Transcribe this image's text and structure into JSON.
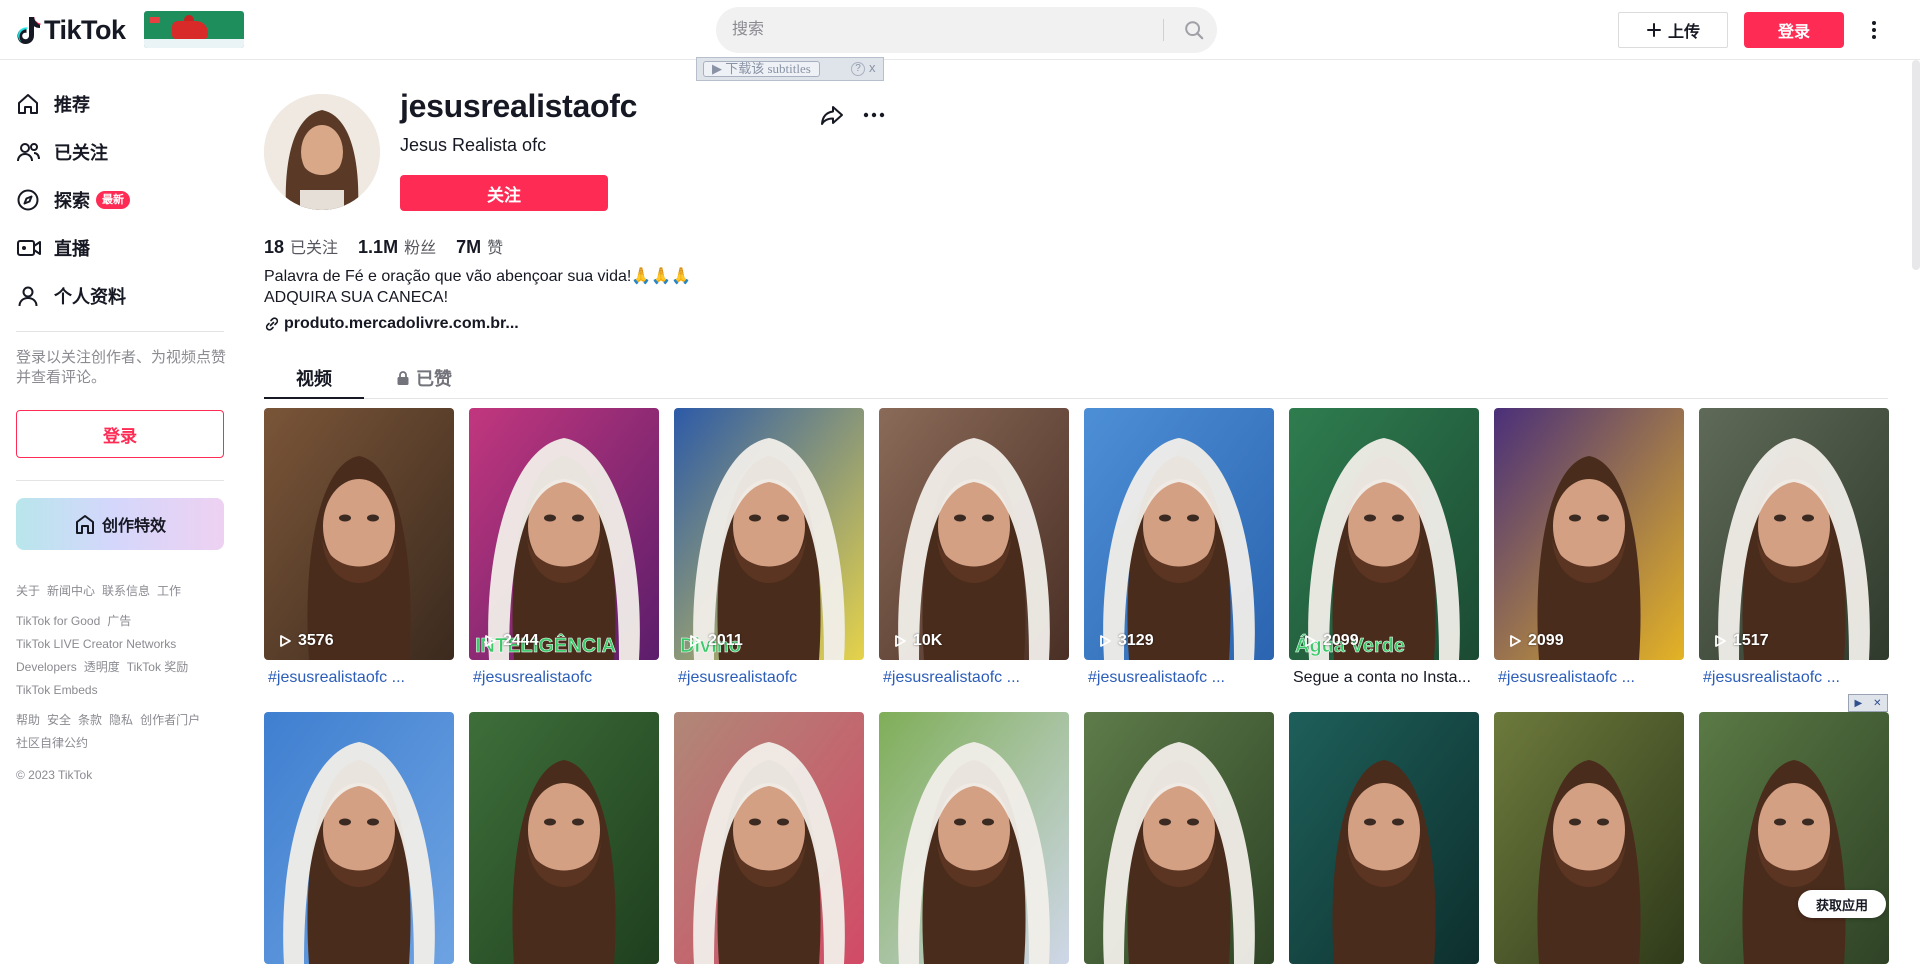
{
  "header": {
    "brand": "TikTok",
    "search_placeholder": "搜索",
    "upload_label": "上传",
    "login_label": "登录"
  },
  "subtitle_bar": {
    "label": "下载该 subtitles",
    "help": "?",
    "close": "x"
  },
  "sidebar": {
    "items": [
      {
        "label": "推荐",
        "icon": "home-icon"
      },
      {
        "label": "已关注",
        "icon": "following-icon"
      },
      {
        "label": "探索",
        "icon": "compass-icon",
        "badge": "最新"
      },
      {
        "label": "直播",
        "icon": "live-icon"
      },
      {
        "label": "个人资料",
        "icon": "profile-icon"
      }
    ],
    "login_prompt": "登录以关注创作者、为视频点赞并查看评论。",
    "login_button": "登录",
    "effects_button": "创作特效",
    "footer_row1": [
      "关于",
      "新闻中心",
      "联系信息",
      "工作"
    ],
    "footer_row2": [
      "TikTok for Good",
      "广告",
      "TikTok LIVE Creator Networks",
      "Developers",
      "透明度",
      "TikTok 奖励",
      "TikTok Embeds"
    ],
    "footer_row3": [
      "帮助",
      "安全",
      "条款",
      "隐私",
      "创作者门户",
      "社区自律公约"
    ],
    "copyright": "© 2023 TikTok"
  },
  "profile": {
    "username": "jesusrealistaofc",
    "nickname": "Jesus Realista ofc",
    "follow_button": "关注",
    "stats": [
      {
        "value": "18",
        "label": "已关注"
      },
      {
        "value": "1.1M",
        "label": "粉丝"
      },
      {
        "value": "7M",
        "label": "赞"
      }
    ],
    "bio_line1": "Palavra de Fé e oração que vão abençoar sua vida!🙏🙏🙏",
    "bio_line2": "ADQUIRA SUA CANECA!",
    "link": "produto.mercadolivre.com.br..."
  },
  "tabs": [
    {
      "label": "视频",
      "active": true
    },
    {
      "label": "已赞",
      "locked": true
    }
  ],
  "videos_row1": [
    {
      "views": "3576",
      "caption": "#jesusrealistaofc ...",
      "bg": "#7a5538",
      "bg2": "#3b2a1e",
      "veil": false,
      "overlay": ""
    },
    {
      "views": "2444",
      "caption": "#jesusrealistaofc",
      "bg": "#c2377e",
      "bg2": "#5b1d6b",
      "veil": true,
      "overlay": "INTELIGÊNCIA"
    },
    {
      "views": "2011",
      "caption": "#jesusrealistaofc",
      "bg": "#2c5aa8",
      "bg2": "#e6d34a",
      "veil": true,
      "overlay": "Divino"
    },
    {
      "views": "10K",
      "caption": "#jesusrealistaofc ...",
      "bg": "#8a6a58",
      "bg2": "#4a2f25",
      "veil": true,
      "overlay": ""
    },
    {
      "views": "3129",
      "caption": "#jesusrealistaofc ...",
      "bg": "#4d8fd6",
      "bg2": "#2b64b0",
      "veil": true,
      "overlay": ""
    },
    {
      "views": "2099",
      "caption": "Segue a conta no Insta...",
      "bg": "#2f7d4f",
      "bg2": "#1b4a33",
      "veil": true,
      "overlay": "Água Verde",
      "plain": true
    },
    {
      "views": "2099",
      "caption": "#jesusrealistaofc ...",
      "bg": "#4a2f7a",
      "bg2": "#e4b325",
      "veil": false,
      "overlay": ""
    },
    {
      "views": "1517",
      "caption": "#jesusrealistaofc ...",
      "bg": "#5f6a58",
      "bg2": "#2f3a2c",
      "veil": true,
      "overlay": ""
    }
  ],
  "videos_row2": [
    {
      "bg": "#3f7fd0",
      "bg2": "#6ea3e2",
      "veil": true
    },
    {
      "bg": "#3e6f3a",
      "bg2": "#1f3f1e",
      "veil": false
    },
    {
      "bg": "#b08878",
      "bg2": "#d24a66",
      "veil": true
    },
    {
      "bg": "#7fae58",
      "bg2": "#cfd7e8",
      "veil": true
    },
    {
      "bg": "#5e7c4a",
      "bg2": "#2e4426",
      "veil": true
    },
    {
      "bg": "#1e5f5a",
      "bg2": "#0d2f2d",
      "veil": false
    },
    {
      "bg": "#6d7a3c",
      "bg2": "#2f3a1a",
      "veil": false
    },
    {
      "bg": "#5a7a45",
      "bg2": "#2f4226",
      "veil": false
    }
  ],
  "get_app": "获取应用",
  "colors": {
    "accent": "#fe2c55",
    "link": "#2b5db9",
    "text": "#161823",
    "muted": "#8a8b91"
  }
}
